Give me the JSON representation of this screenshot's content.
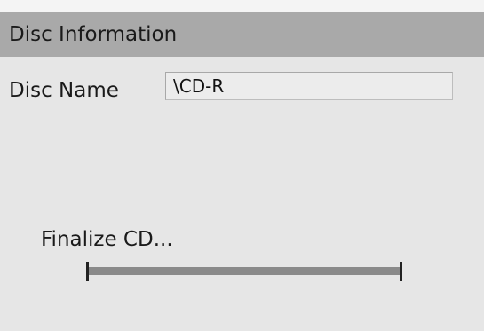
{
  "panel": {
    "title": "Disc Information"
  },
  "disc": {
    "name_label": "Disc Name",
    "name_value": "\\CD-R"
  },
  "progress": {
    "label": "Finalize CD...",
    "fraction": 1.0,
    "bar_color": "#8a8a8a"
  }
}
